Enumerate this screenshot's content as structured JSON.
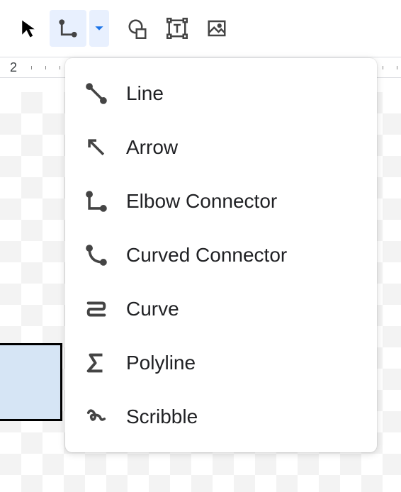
{
  "toolbar": {
    "tools": [
      "select",
      "line",
      "shape",
      "textbox",
      "image"
    ]
  },
  "ruler": {
    "number": "2"
  },
  "dropdown": {
    "items": [
      {
        "icon": "line",
        "label": "Line"
      },
      {
        "icon": "arrow",
        "label": "Arrow"
      },
      {
        "icon": "elbow",
        "label": "Elbow Connector"
      },
      {
        "icon": "curved",
        "label": "Curved Connector"
      },
      {
        "icon": "curve",
        "label": "Curve"
      },
      {
        "icon": "polyline",
        "label": "Polyline"
      },
      {
        "icon": "scribble",
        "label": "Scribble"
      }
    ]
  }
}
